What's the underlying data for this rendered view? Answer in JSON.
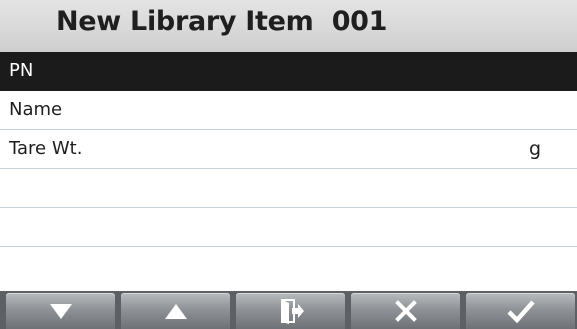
{
  "header": {
    "title": "New Library Item  001"
  },
  "rows": [
    {
      "label": "PN",
      "unit": "",
      "selected": true
    },
    {
      "label": "Name",
      "unit": "",
      "selected": false
    },
    {
      "label": "Tare Wt.",
      "unit": "g",
      "selected": false
    },
    {
      "label": "",
      "unit": "",
      "selected": false
    },
    {
      "label": "",
      "unit": "",
      "selected": false
    },
    {
      "label": "",
      "unit": "",
      "selected": false
    }
  ],
  "softkeys": [
    {
      "icon": "arrow-down-icon"
    },
    {
      "icon": "arrow-up-icon"
    },
    {
      "icon": "exit-door-icon"
    },
    {
      "icon": "close-icon"
    },
    {
      "icon": "checkmark-icon"
    }
  ],
  "colors": {
    "selected_row": "#1b1b1b",
    "title_bar": "#d8d8d8",
    "softkey_bar": "#5d6165",
    "divider": "#c6d0da"
  }
}
